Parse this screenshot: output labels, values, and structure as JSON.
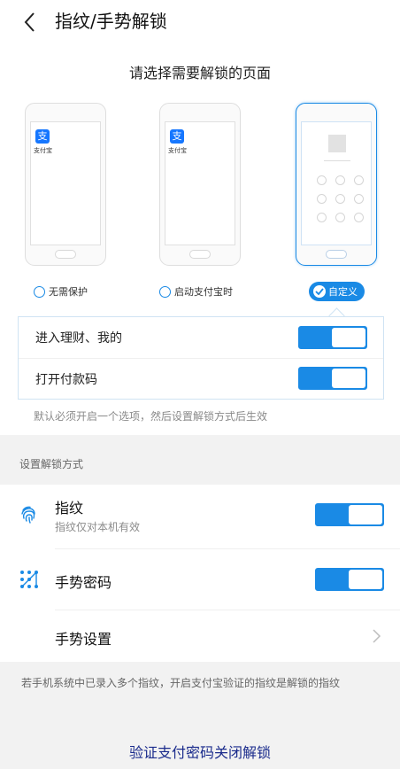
{
  "header": {
    "title": "指纹/手势解锁",
    "back_icon": "back-arrow-icon"
  },
  "select": {
    "title": "请选择需要解锁的页面",
    "phones": [
      {
        "brand": "支付宝",
        "logo_glyph": "支"
      },
      {
        "brand": "支付宝",
        "logo_glyph": "支"
      },
      {
        "brand": "",
        "logo_glyph": ""
      }
    ],
    "options": [
      {
        "label": "无需保护",
        "selected": false
      },
      {
        "label": "启动支付宝时",
        "selected": false
      },
      {
        "label": "自定义",
        "selected": true
      }
    ]
  },
  "custom": {
    "rows": [
      {
        "label": "进入理财、我的",
        "enabled": true
      },
      {
        "label": "打开付款码",
        "enabled": true
      }
    ],
    "hint": "默认必须开启一个选项，然后设置解锁方式后生效"
  },
  "methods": {
    "section_label": "设置解锁方式",
    "fingerprint": {
      "title": "指纹",
      "subtitle": "指纹仅对本机有效",
      "enabled": true,
      "icon": "fingerprint-icon"
    },
    "gesture": {
      "title": "手势密码",
      "enabled": true,
      "icon": "gesture-pattern-icon"
    },
    "gesture_settings": {
      "title": "手势设置",
      "icon": "chevron-right-icon"
    }
  },
  "footer": {
    "note": "若手机系统中已录入多个指纹，开启支付宝验证的指纹是解锁的指纹",
    "link": "验证支付密码关闭解锁"
  },
  "colors": {
    "accent": "#1a8ae5",
    "link": "#1a2b8c",
    "background_gray": "#f2f2f2"
  }
}
